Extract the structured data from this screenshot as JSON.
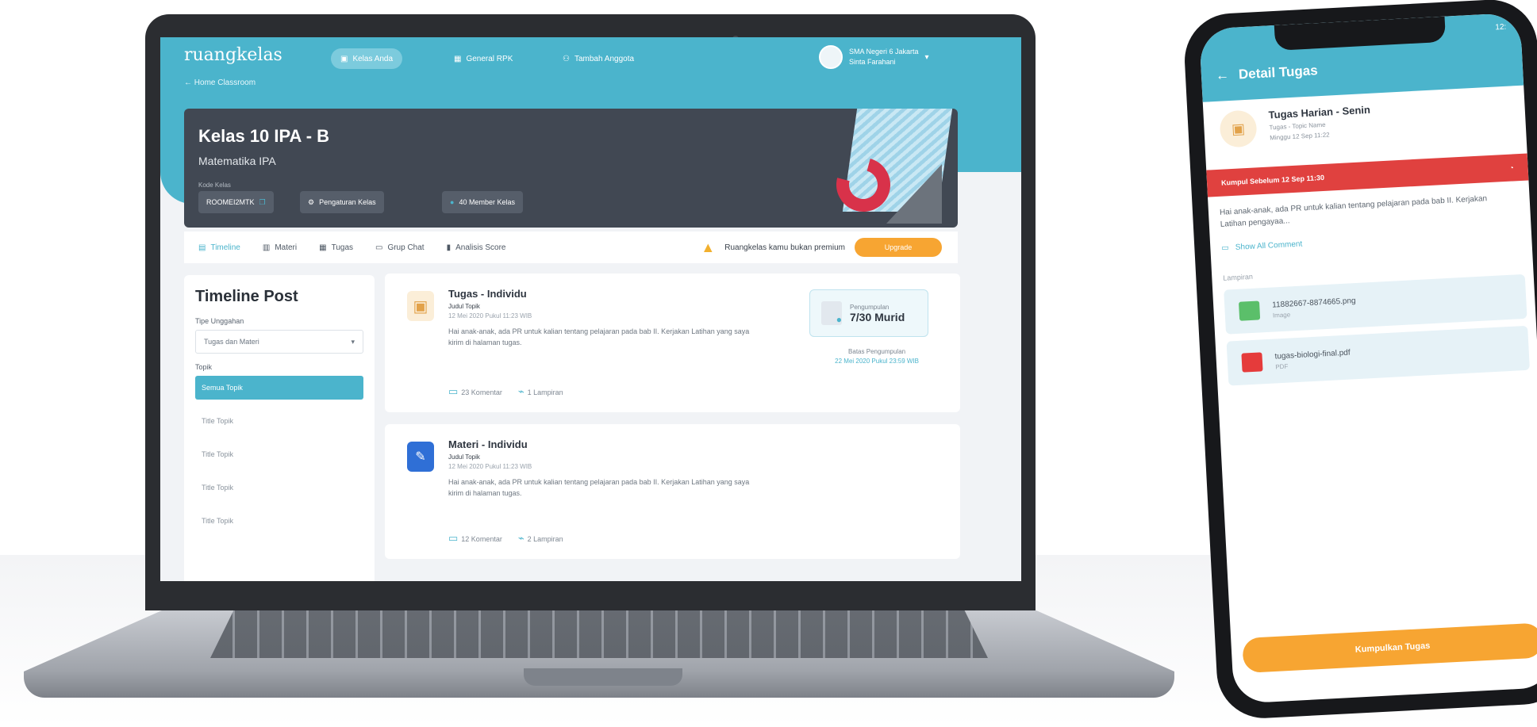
{
  "laptop": {
    "app": {
      "logo": "ruangkelas",
      "back_link": "Home Classroom",
      "nav": [
        {
          "label": "Kelas Anda",
          "icon": "class-icon"
        },
        {
          "label": "General RPK",
          "icon": "grid-icon"
        },
        {
          "label": "Tambah Anggota",
          "icon": "add-user-icon"
        }
      ],
      "user": {
        "school": "SMA Negeri 6 Jakarta",
        "name": "Sinta Farahani"
      }
    },
    "class_card": {
      "title": "Kelas 10 IPA - B",
      "subject": "Matematika IPA",
      "code_label": "Kode Kelas",
      "code": "ROOMEI2MTK",
      "settings_label": "Pengaturan Kelas",
      "members_label": "40 Member Kelas"
    },
    "tabs": [
      {
        "label": "Timeline",
        "icon": "timeline-icon",
        "active": true
      },
      {
        "label": "Materi",
        "icon": "book-icon"
      },
      {
        "label": "Tugas",
        "icon": "clipboard-icon"
      },
      {
        "label": "Grup Chat",
        "icon": "chat-icon"
      },
      {
        "label": "Analisis Score",
        "icon": "bar-chart-icon"
      }
    ],
    "promo": {
      "text": "Ruangkelas kamu bukan premium",
      "button": "Upgrade"
    },
    "sidebar": {
      "title": "Timeline Post",
      "filter_label": "Tipe Unggahan",
      "filter_value": "Tugas dan Materi",
      "topic_label": "Topik",
      "topics": [
        "Semua Topik",
        "Title Topik",
        "Title Topik",
        "Title Topik",
        "Title Topik"
      ]
    },
    "posts": [
      {
        "title": "Tugas - Individu",
        "topic": "Judul Topik",
        "date": "12 Mei 2020 Pukul 11:23 WIB",
        "body": "Hai anak-anak, ada PR untuk kalian tentang pelajaran pada bab II. Kerjakan Latihan yang saya kirim di halaman tugas.",
        "comments": "23 Komentar",
        "attachments": "1 Lampiran",
        "submission_label": "Pengumpulan",
        "submission_value": "7/30 Murid",
        "deadline_label": "Batas Pengumpulan",
        "deadline_value": "22 Mei 2020 Pukul 23:59 WIB"
      },
      {
        "title": "Materi - Individu",
        "topic": "Judul Topik",
        "date": "12 Mei 2020 Pukul 11:23 WIB",
        "body": "Hai anak-anak, ada PR untuk kalian tentang pelajaran pada bab II. Kerjakan Latihan yang saya kirim di halaman tugas.",
        "comments": "12 Komentar",
        "attachments": "2 Lampiran"
      }
    ]
  },
  "phone": {
    "status_time": "12:",
    "header_title": "Detail Tugas",
    "task_title": "Tugas Harian - Senin",
    "task_topic": "Tugas - Topic Name",
    "task_date": "Minggu 12 Sep 11:22",
    "deadline_banner": "Kumpul Sebelum 12 Sep 11:30",
    "description": "Hai anak-anak, ada PR untuk kalian tentang pelajaran pada bab II. Kerjakan Latihan pengayaa...",
    "show_all": "Show All Comment",
    "attachments_label": "Lampiran",
    "attachments": [
      {
        "name": "11882667-8874665.png",
        "type": "Image"
      },
      {
        "name": "tugas-biologi-final.pdf",
        "type": "PDF"
      }
    ],
    "submit_button": "Kumpulkan Tugas"
  },
  "colors": {
    "primary": "#4bb4cc",
    "accent": "#f7a532",
    "danger": "#e0413f",
    "dark_card": "#414853"
  }
}
